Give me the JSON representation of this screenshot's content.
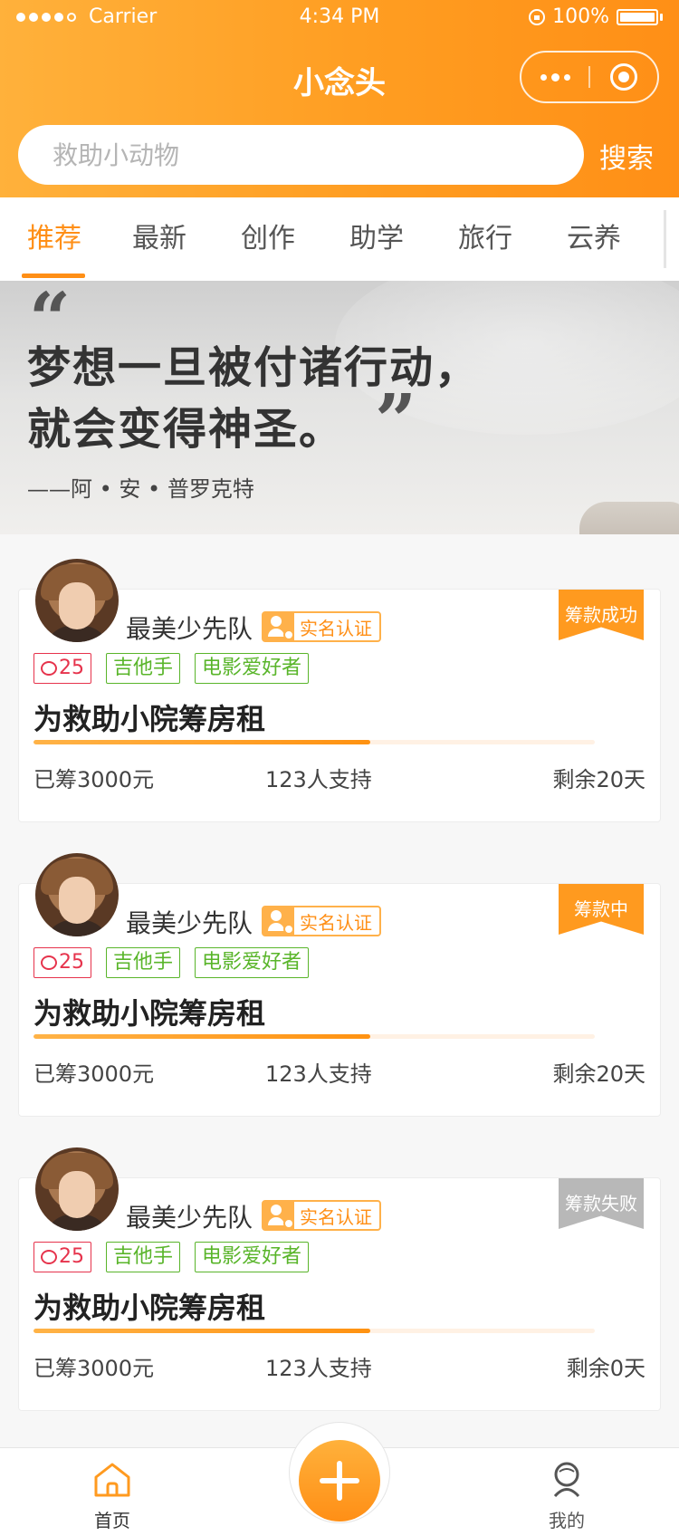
{
  "status_bar": {
    "carrier": "Carrier",
    "time": "4:34 PM",
    "battery": "100%"
  },
  "nav": {
    "title": "小念头",
    "more_icon": "more-dots-icon",
    "close_icon": "target-close-icon"
  },
  "search": {
    "placeholder": "救助小动物",
    "button": "搜索"
  },
  "tabs": [
    "推荐",
    "最新",
    "创作",
    "助学",
    "旅行",
    "云养"
  ],
  "active_tab": 0,
  "banner": {
    "quote_line1": "梦想一旦被付诸行动，",
    "quote_line2": "就会变得神圣。",
    "author": "——阿 • 安 • 普罗克特",
    "quote_open": "“",
    "quote_close": "”"
  },
  "cards": [
    {
      "user": "最美少先队",
      "verify": "实名认证",
      "badge": "筹款成功",
      "badge_status": "success",
      "comments": "25",
      "tags": [
        "吉他手",
        "电影爱好者"
      ],
      "title": "为救助小院筹房租",
      "progress": 0.6,
      "raised": "已筹3000元",
      "supporters": "123人支持",
      "remaining": "剩余20天"
    },
    {
      "user": "最美少先队",
      "verify": "实名认证",
      "badge": "筹款中",
      "badge_status": "ongoing",
      "comments": "25",
      "tags": [
        "吉他手",
        "电影爱好者"
      ],
      "title": "为救助小院筹房租",
      "progress": 0.6,
      "raised": "已筹3000元",
      "supporters": "123人支持",
      "remaining": "剩余20天"
    },
    {
      "user": "最美少先队",
      "verify": "实名认证",
      "badge": "筹款失败",
      "badge_status": "failed",
      "comments": "25",
      "tags": [
        "吉他手",
        "电影爱好者"
      ],
      "title": "为救助小院筹房租",
      "progress": 0.6,
      "raised": "已筹3000元",
      "supporters": "123人支持",
      "remaining": "剩余0天"
    }
  ],
  "tabbar": {
    "home": "首页",
    "me": "我的",
    "add_icon": "plus-icon"
  },
  "colors": {
    "accent": "#ff8f16",
    "accent_light": "#ffb13b",
    "tag_red": "#e6334c",
    "tag_green": "#59b52a",
    "failed_gray": "#b8b8b8"
  }
}
